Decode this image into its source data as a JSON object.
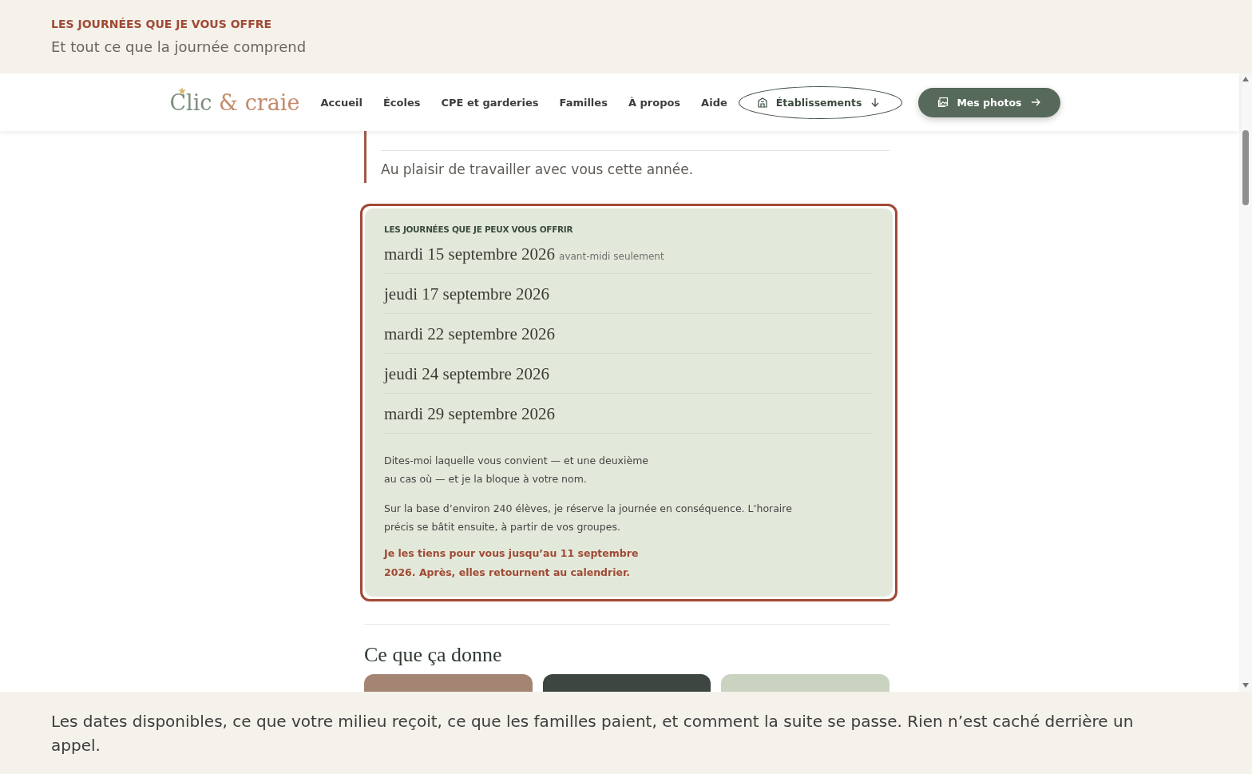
{
  "top_banner": {
    "eyebrow": "LES JOURNÉES QUE JE VOUS OFFRE",
    "subtitle": "Et tout ce que la journée comprend"
  },
  "header": {
    "logo": {
      "first": "Clic",
      "second": "& craie"
    },
    "nav": [
      "Accueil",
      "Écoles",
      "CPE et garderies",
      "Familles",
      "À propos",
      "Aide"
    ],
    "buttons": [
      {
        "kind": "outline",
        "label": "Établissements"
      },
      {
        "kind": "filled",
        "label": "Mes photos"
      }
    ]
  },
  "quote": {
    "lines": [
      "Au plaisir de travailler avec vous cette année."
    ]
  },
  "dates_card": {
    "heading": "LES JOURNÉES QUE JE PEUX VOUS OFFRIR",
    "dates": [
      {
        "date": "mardi 15 septembre 2026",
        "note": "avant-midi seulement"
      },
      {
        "date": "jeudi 17 septembre 2026"
      },
      {
        "date": "mardi 22 septembre 2026"
      },
      {
        "date": "jeudi 24 septembre 2026"
      },
      {
        "date": "mardi 29 septembre 2026"
      }
    ],
    "paragraphs": [
      "Dites-moi laquelle vous convient — et une deuxième au cas où — et je la bloque à votre nom.",
      "Sur la base d’environ 240 élèves, je réserve la journée en conséquence. L’horaire précis se bâtit ensuite, à partir de vos groupes."
    ],
    "deadline": "Je les tiens pour vous jusqu’au 11 septembre 2026. Après, elles retournent au calendrier."
  },
  "gallery": {
    "title": "Ce que ça donne"
  },
  "bottom_banner": {
    "text": "Les dates disponibles, ce que votre milieu reçoit, ce que les familles paient, et comment la suite se passe. Rien n’est caché derrière un appel."
  }
}
